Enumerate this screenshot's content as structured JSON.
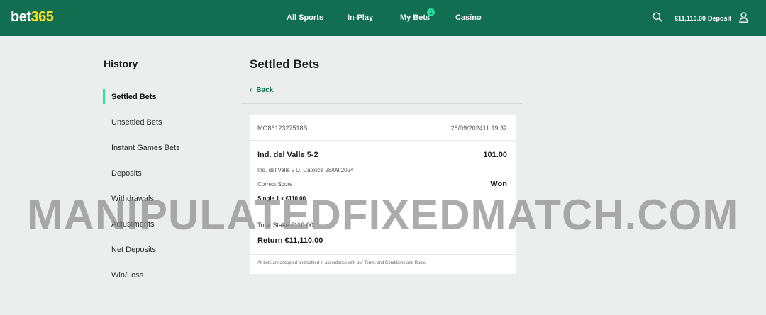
{
  "header": {
    "logo_part1": "bet",
    "logo_part2": "365",
    "nav": [
      "All Sports",
      "In-Play",
      "My Bets",
      "Casino"
    ],
    "my_bets_badge": "1",
    "balance": "€11,110.00",
    "deposit_label": "Deposit",
    "colors": {
      "bar": "#126e51",
      "logo_accent": "#ffdf1b",
      "badge": "#27e0a3"
    }
  },
  "sidebar": {
    "title": "History",
    "items": [
      {
        "label": "Settled Bets",
        "active": true
      },
      {
        "label": "Unsettled Bets",
        "active": false
      },
      {
        "label": "Instant Games Bets",
        "active": false
      },
      {
        "label": "Deposits",
        "active": false
      },
      {
        "label": "Withdrawals",
        "active": false
      },
      {
        "label": "Adjustments",
        "active": false
      },
      {
        "label": "Net Deposits",
        "active": false
      },
      {
        "label": "Win/Loss",
        "active": false
      }
    ]
  },
  "main": {
    "title": "Settled Bets",
    "back_label": "Back",
    "bet": {
      "reference": "MO8612327518B",
      "datetime": "28/09/202411:19:32",
      "selection": "Ind. del Valle 5-2",
      "odds": "101.00",
      "event": "Ind. del Valle v U. Catolica 28/09/2024",
      "market": "Correct Score",
      "result": "Won",
      "bet_type": "Single 1 x €110.00",
      "total_stake": "Total Stake €110.00",
      "return": "Return €11,110.00",
      "terms": "All bets are accepted and settled in accordance with our Terms and Conditions and Rules."
    }
  },
  "watermark": "MANIPULATEDFIXEDMATCH.COM"
}
